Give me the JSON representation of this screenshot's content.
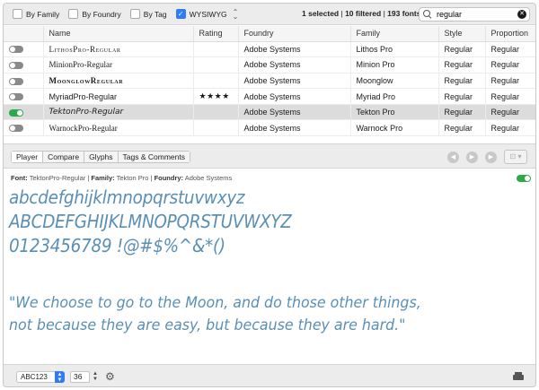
{
  "toolbar": {
    "filters": [
      {
        "label": "By Family",
        "checked": false
      },
      {
        "label": "By Foundry",
        "checked": false
      },
      {
        "label": "By Tag",
        "checked": false
      },
      {
        "label": "WYSIWYG",
        "checked": true
      }
    ],
    "status": {
      "selected": "1 selected",
      "filtered": "10 filtered",
      "total": "193 fonts",
      "sep": " | "
    },
    "search": {
      "value": "regular",
      "placeholder": "Search"
    }
  },
  "table": {
    "columns": [
      "",
      "Name",
      "Rating",
      "Foundry",
      "Family",
      "Style",
      "Proportion"
    ],
    "rows": [
      {
        "active": false,
        "name": "LithosPro-Regular",
        "rating": "",
        "foundry": "Adobe Systems",
        "family": "Lithos Pro",
        "style": "Regular",
        "proportion": "Regular"
      },
      {
        "active": false,
        "name": "MinionPro-Regular",
        "rating": "",
        "foundry": "Adobe Systems",
        "family": "Minion Pro",
        "style": "Regular",
        "proportion": "Regular"
      },
      {
        "active": false,
        "name": "MoonglowRegular",
        "rating": "",
        "foundry": "Adobe Systems",
        "family": "Moonglow",
        "style": "Regular",
        "proportion": "Regular"
      },
      {
        "active": false,
        "name": "MyriadPro-Regular",
        "rating": "★★★★",
        "foundry": "Adobe Systems",
        "family": "Myriad Pro",
        "style": "Regular",
        "proportion": "Regular"
      },
      {
        "active": true,
        "name": "TektonPro-Regular",
        "rating": "",
        "foundry": "Adobe Systems",
        "family": "Tekton Pro",
        "style": "Regular",
        "proportion": "Regular"
      },
      {
        "active": false,
        "name": "WarnockPro-Regular",
        "rating": "",
        "foundry": "Adobe Systems",
        "family": "Warnock Pro",
        "style": "Regular",
        "proportion": "Regular"
      }
    ]
  },
  "tabs": [
    "Player",
    "Compare",
    "Glyphs",
    "Tags & Comments"
  ],
  "nav": {
    "back": "◀",
    "play": "▶",
    "forward": "▶",
    "camera": "⊡ ▾"
  },
  "preview": {
    "font_label": "Font:",
    "font": "TektonPro-Regular",
    "family_label": "Family:",
    "family": "Tekton Pro",
    "foundry_label": "Foundry:",
    "foundry": "Adobe Systems",
    "lines": [
      "abcdefghijklmnopqrstuvwxyz",
      "ABCDEFGHIJKLMNOPQRSTUVWXYZ",
      "0123456789 !@#$%^&*()"
    ],
    "quote": [
      "\"We choose to go to the Moon, and do those other things,",
      "not because they are easy, but because they are hard.\""
    ]
  },
  "bottombar": {
    "sample": "ABC123",
    "size": "36"
  }
}
